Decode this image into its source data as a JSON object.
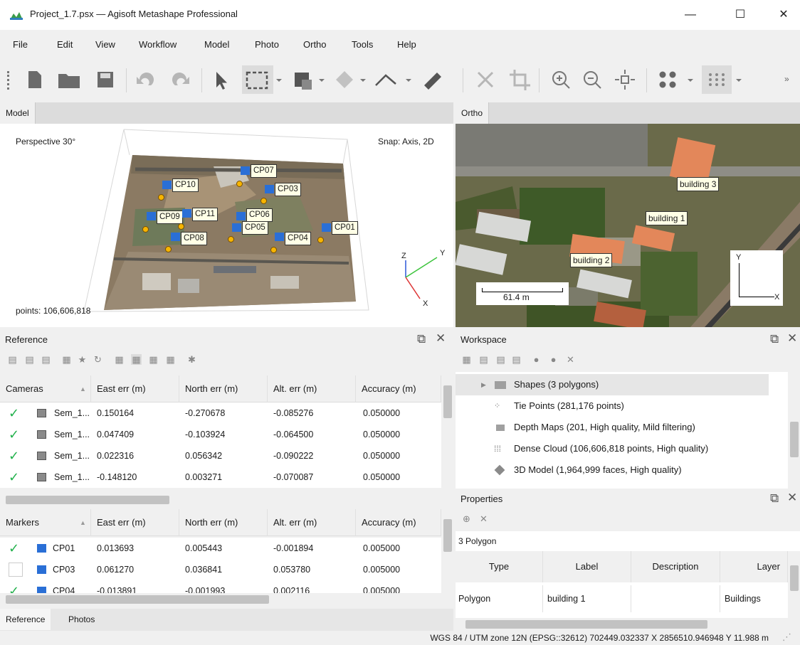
{
  "window": {
    "title": "Project_1.7.psx — Agisoft Metashape Professional",
    "controls": [
      "—",
      "☐",
      "✕"
    ]
  },
  "menu": [
    "File",
    "Edit",
    "View",
    "Workflow",
    "Model",
    "Photo",
    "Ortho",
    "Tools",
    "Help"
  ],
  "toolbar": {
    "items": [
      "new-document",
      "open-folder",
      "save",
      "undo",
      "redo",
      "navigation-pointer",
      "rectangle-selection",
      "paint-selection",
      "marker-tool",
      "polyline-tool",
      "ruler",
      "delete",
      "crop",
      "zoom-in",
      "zoom-out",
      "reset-view",
      "point-cloud",
      "dense-cloud"
    ],
    "overflow": "»"
  },
  "model_panel": {
    "tab": "Model",
    "perspective": "Perspective 30°",
    "snap": "Snap: Axis, 2D",
    "points": "points: 106,606,818",
    "axes": {
      "z": "Z",
      "y": "Y",
      "x": "X"
    },
    "markers": [
      "CP07",
      "CP10",
      "CP03",
      "CP09",
      "CP11",
      "CP06",
      "CP05",
      "CP01",
      "CP08",
      "CP04"
    ]
  },
  "ortho_panel": {
    "tab": "Ortho",
    "labels": [
      "building 3",
      "building 1",
      "building 2"
    ],
    "scale": "61.4 m",
    "axes": {
      "y": "Y",
      "x": "X"
    }
  },
  "reference": {
    "title": "Reference",
    "cameras": {
      "headers": [
        "Cameras",
        "East err (m)",
        "North err (m)",
        "Alt. err (m)",
        "Accuracy (m)"
      ],
      "rows": [
        [
          "Sem_1...",
          "0.150164",
          "-0.270678",
          "-0.085276",
          "0.050000"
        ],
        [
          "Sem_1...",
          "0.047409",
          "-0.103924",
          "-0.064500",
          "0.050000"
        ],
        [
          "Sem_1...",
          "0.022316",
          "0.056342",
          "-0.090222",
          "0.050000"
        ],
        [
          "Sem_1...",
          "-0.148120",
          "0.003271",
          "-0.070087",
          "0.050000"
        ]
      ]
    },
    "markers": {
      "headers": [
        "Markers",
        "East err (m)",
        "North err (m)",
        "Alt. err (m)",
        "Accuracy (m)"
      ],
      "rows": [
        [
          "CP01",
          "0.013693",
          "0.005443",
          "-0.001894",
          "0.005000"
        ],
        [
          "CP03",
          "0.061270",
          "0.036841",
          "0.053780",
          "0.005000"
        ],
        [
          "CP04",
          "-0.013891",
          "-0.001993",
          "0.002116",
          "0.005000"
        ]
      ]
    },
    "tabs": [
      "Reference",
      "Photos"
    ]
  },
  "workspace": {
    "title": "Workspace",
    "items": [
      "Shapes (3 polygons)",
      "Tie Points (281,176 points)",
      "Depth Maps (201, High quality, Mild filtering)",
      "Dense Cloud (106,606,818 points, High quality)",
      "3D Model (1,964,999 faces, High quality)"
    ]
  },
  "properties": {
    "title": "Properties",
    "caption": "3 Polygon",
    "headers": [
      "Type",
      "Label",
      "Description",
      "Layer"
    ],
    "row": [
      "Polygon",
      "building 1",
      "",
      "Buildings"
    ]
  },
  "status": "WGS 84 / UTM zone 12N (EPSG::32612)  702449.032337 X  2856510.946948 Y  11.988 m"
}
